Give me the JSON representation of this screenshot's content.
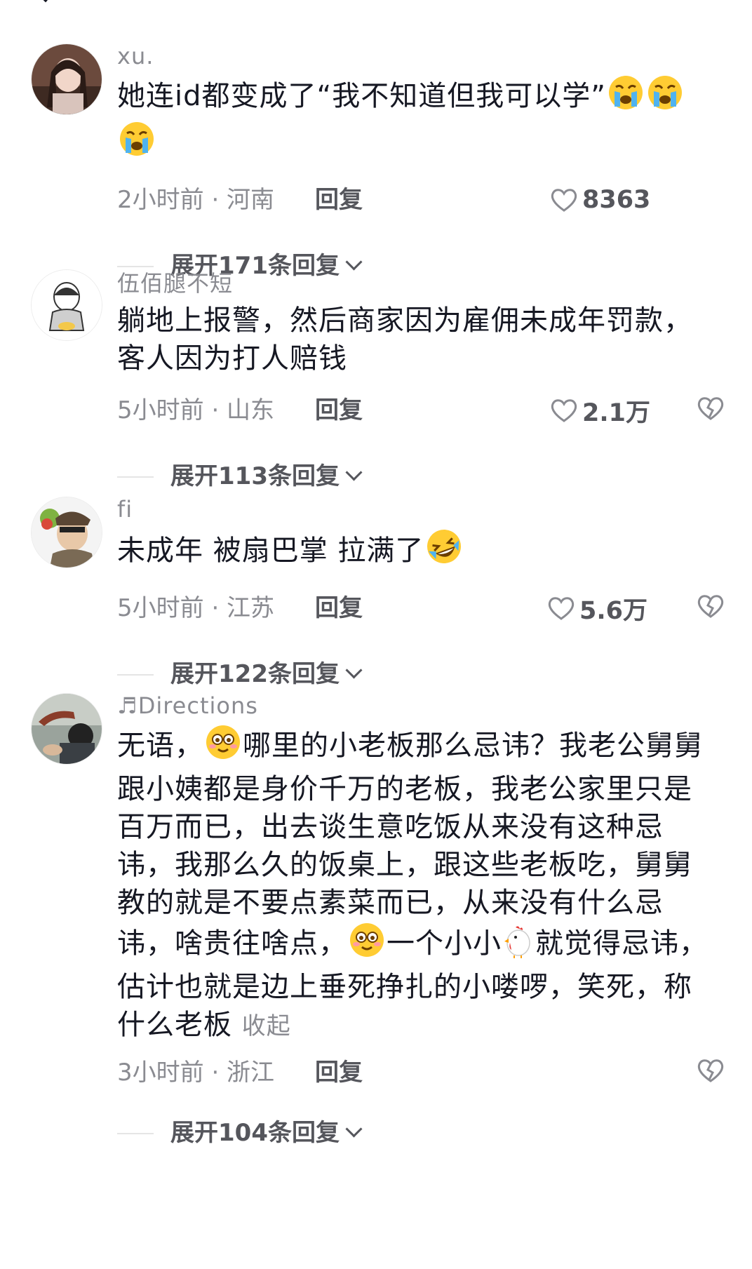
{
  "comments": [
    {
      "username": "xu.",
      "text": "她连id都变成了“我不知道但我可以学”",
      "time": "2小时前 · 河南",
      "reply": "回复",
      "likes": "8363",
      "expand": "展开171条回复"
    },
    {
      "username": "伍佰腿不短",
      "text_line1": "躺地上报警，然后商家因为雇佣未成年罚款，",
      "text_line2": "客人因为打人赔钱",
      "time": "5小时前 · 山东",
      "reply": "回复",
      "likes": "2.1万",
      "expand": "展开113条回复"
    },
    {
      "username": "fi",
      "text": "未成年 被扇巴掌 拉满了",
      "time": "5小时前 · 江苏",
      "reply": "回复",
      "likes": "5.6万",
      "expand": "展开122条回复"
    },
    {
      "username": "♬Directions",
      "text_part1": "无语，",
      "text_part2": "哪里的小老板那么忌讳？我老公舅舅跟小姨都是身价千万的老板，我老公家里只是百万而已，出去谈生意吃饭从来没有这种忌讳，我那么久的饭桌上，跟这些老板吃，舅舅教的就是不要点素菜而已，从来没有什么忌讳，啥贵往啥点，",
      "text_part3": "一个小小",
      "text_part4": "就觉得忌讳，估计也就是边上垂死挣扎的小喽啰，笑死，称什么老板",
      "collapse": "收起",
      "time": "3小时前 · 浙江",
      "reply": "回复",
      "expand": "展开104条回复"
    }
  ],
  "icons": {
    "like": "heart-outline-icon",
    "dislike": "broken-heart-icon",
    "emoji_cry": "loudly-crying-emoji",
    "emoji_laugh": "rolling-laughing-emoji",
    "emoji_flushed": "smiling-eyes-emoji",
    "emoji_chicken": "chicken-emoji"
  },
  "colors": {
    "primary_text": "#161823",
    "secondary_text": "#8a8b91",
    "action_text": "#55565c"
  }
}
